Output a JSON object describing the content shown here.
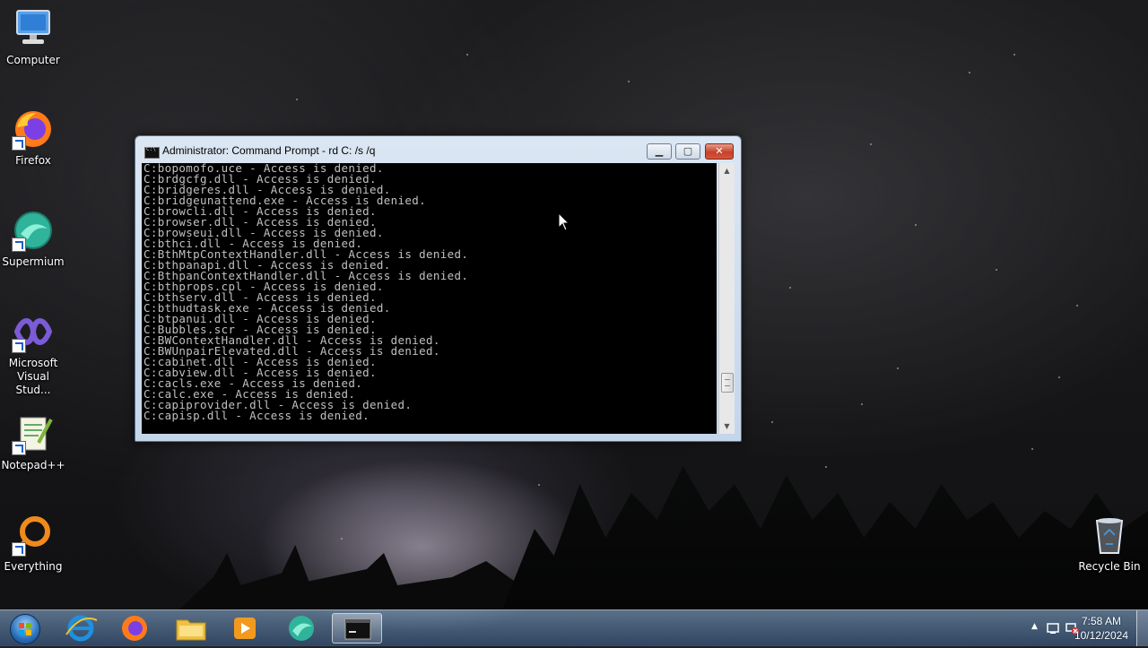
{
  "desktop": {
    "icons": [
      {
        "label": "Computer"
      },
      {
        "label": "Firefox"
      },
      {
        "label": "Supermium"
      },
      {
        "label": "Microsoft Visual Stud..."
      },
      {
        "label": "Notepad++"
      },
      {
        "label": "Everything"
      },
      {
        "label": "Recycle Bin"
      }
    ]
  },
  "window": {
    "title": "Administrator:  Command Prompt - rd  C: /s /q",
    "buttons": {
      "minimize": "▁",
      "maximize": "▢",
      "close": "✕"
    },
    "console_lines": [
      "C:bopomofo.uce - Access is denied.",
      "C:brdgcfg.dll - Access is denied.",
      "C:bridgeres.dll - Access is denied.",
      "C:bridgeunattend.exe - Access is denied.",
      "C:browcli.dll - Access is denied.",
      "C:browser.dll - Access is denied.",
      "C:browseui.dll - Access is denied.",
      "C:bthci.dll - Access is denied.",
      "C:BthMtpContextHandler.dll - Access is denied.",
      "C:bthpanapi.dll - Access is denied.",
      "C:BthpanContextHandler.dll - Access is denied.",
      "C:bthprops.cpl - Access is denied.",
      "C:bthserv.dll - Access is denied.",
      "C:bthudtask.exe - Access is denied.",
      "C:btpanui.dll - Access is denied.",
      "C:Bubbles.scr - Access is denied.",
      "C:BWContextHandler.dll - Access is denied.",
      "C:BWUnpairElevated.dll - Access is denied.",
      "C:cabinet.dll - Access is denied.",
      "C:cabview.dll - Access is denied.",
      "C:cacls.exe - Access is denied.",
      "C:calc.exe - Access is denied.",
      "C:capiprovider.dll - Access is denied.",
      "C:capisp.dll - Access is denied."
    ]
  },
  "taskbar": {
    "apps": [
      "internet-explorer",
      "firefox",
      "file-explorer",
      "media-player",
      "supermium",
      "command-prompt"
    ],
    "clock": {
      "time": "7:58 AM",
      "date": "10/12/2024"
    }
  }
}
